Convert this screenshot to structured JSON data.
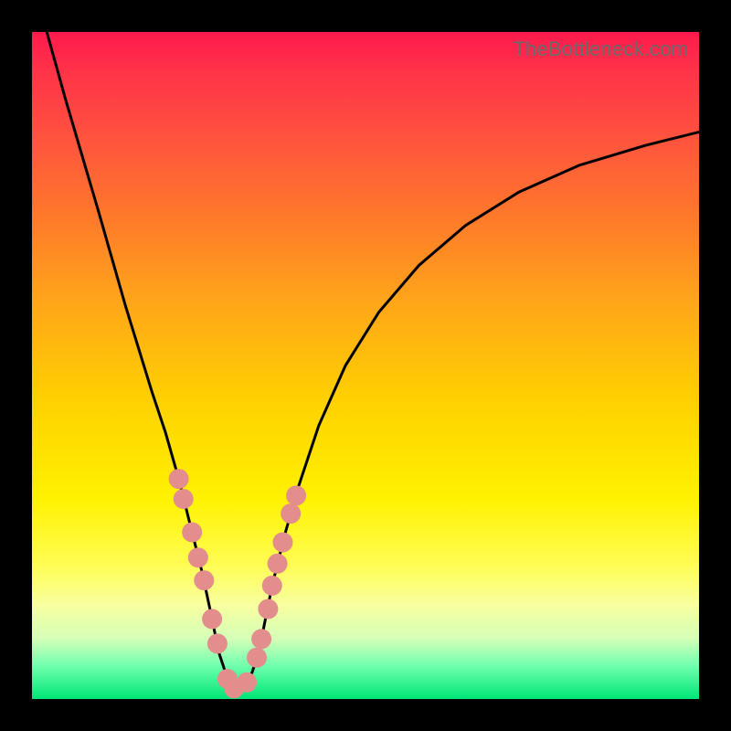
{
  "watermark": "TheBottleneck.com",
  "colors": {
    "background": "#000000",
    "gradient_top": "#ff1a4d",
    "gradient_bottom": "#00e676",
    "curve": "#000000",
    "markers": "#e38d8d"
  },
  "chart_data": {
    "type": "line",
    "title": "",
    "xlabel": "",
    "ylabel": "",
    "xlim": [
      0,
      100
    ],
    "ylim": [
      0,
      100
    ],
    "grid": false,
    "legend": false,
    "annotations": [
      "TheBottleneck.com"
    ],
    "series": [
      {
        "name": "bottleneck-curve",
        "x": [
          0,
          5,
          10,
          14,
          18,
          20,
          22,
          24,
          25.5,
          27,
          28,
          29,
          30,
          31,
          32,
          33,
          34,
          35,
          36,
          38,
          40,
          43,
          47,
          52,
          58,
          65,
          73,
          82,
          92,
          100
        ],
        "y": [
          108,
          90,
          73,
          59,
          46,
          40,
          33,
          25,
          19,
          12,
          7,
          4,
          2,
          1,
          2,
          4,
          7,
          12,
          17,
          25,
          32,
          41,
          50,
          58,
          65,
          71,
          76,
          80,
          83,
          85
        ]
      },
      {
        "name": "highlight-markers",
        "x": [
          22.0,
          22.7,
          24.0,
          24.9,
          25.8,
          27.0,
          27.8,
          29.3,
          30.3,
          32.2,
          33.7,
          34.4,
          35.4,
          36.0,
          36.8,
          37.6,
          38.8,
          39.6
        ],
        "y": [
          33.0,
          30.0,
          25.0,
          21.2,
          17.8,
          12.0,
          8.3,
          3.0,
          1.6,
          2.5,
          6.2,
          9.0,
          13.5,
          17.0,
          20.3,
          23.5,
          27.8,
          30.5
        ]
      }
    ]
  }
}
